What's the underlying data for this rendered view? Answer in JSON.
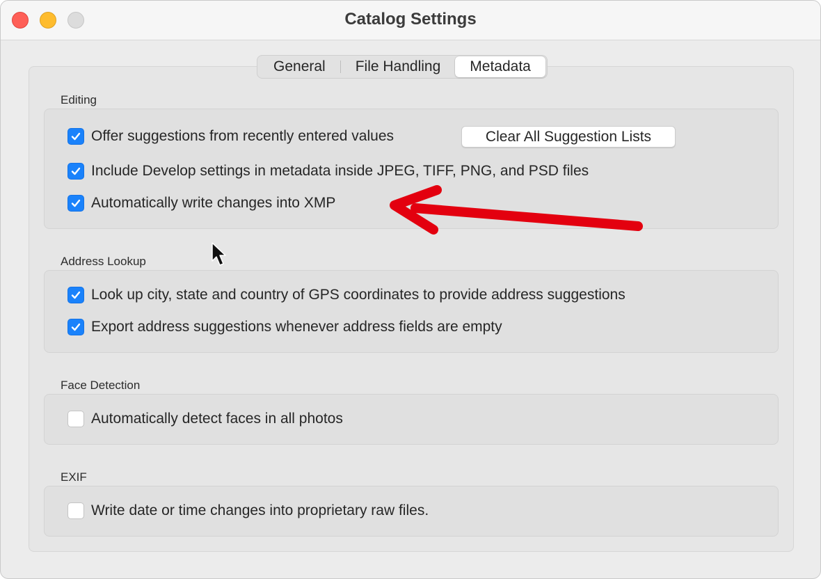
{
  "window": {
    "title": "Catalog Settings"
  },
  "tabs": [
    {
      "label": "General",
      "active": false
    },
    {
      "label": "File Handling",
      "active": false
    },
    {
      "label": "Metadata",
      "active": true
    }
  ],
  "sections": {
    "editing": {
      "label": "Editing",
      "options": [
        {
          "label": "Offer suggestions from recently entered values",
          "checked": true
        },
        {
          "label": "Include Develop settings in metadata inside JPEG, TIFF, PNG, and PSD files",
          "checked": true
        },
        {
          "label": "Automatically write changes into XMP",
          "checked": true
        }
      ],
      "clear_button": "Clear All Suggestion Lists"
    },
    "address": {
      "label": "Address Lookup",
      "options": [
        {
          "label": "Look up city, state and country of GPS coordinates to provide address suggestions",
          "checked": true
        },
        {
          "label": "Export address suggestions whenever address fields are empty",
          "checked": true
        }
      ]
    },
    "face": {
      "label": "Face Detection",
      "options": [
        {
          "label": "Automatically detect faces in all photos",
          "checked": false
        }
      ]
    },
    "exif": {
      "label": "EXIF",
      "options": [
        {
          "label": "Write date or time changes into proprietary raw files.",
          "checked": false
        }
      ]
    }
  },
  "colors": {
    "checkbox_on": "#1a82fb",
    "annotation_arrow": "#e3000f",
    "close": "#fe5f57",
    "minimize": "#febc2e"
  }
}
